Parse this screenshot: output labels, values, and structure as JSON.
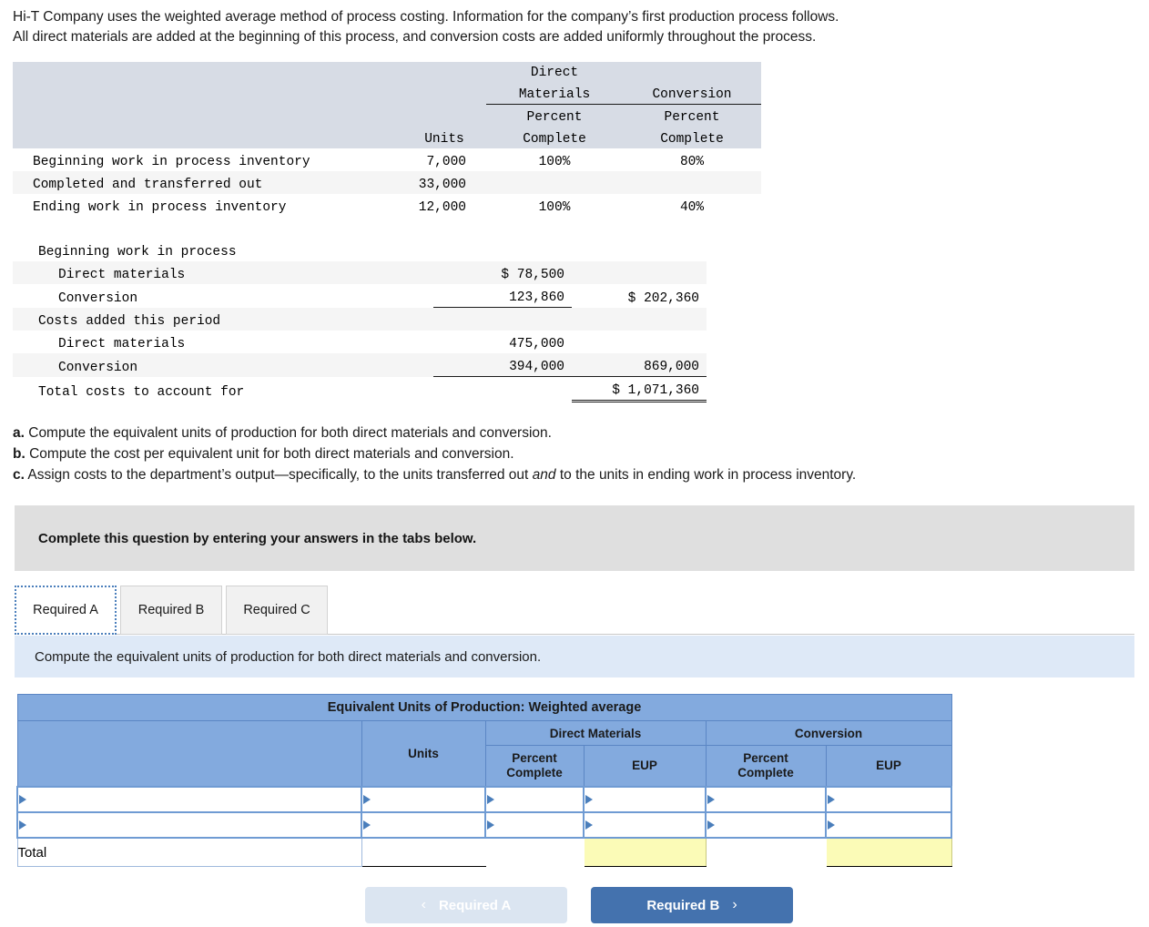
{
  "intro": {
    "line1": "Hi-T Company uses the weighted average method of process costing. Information for the company’s first production process follows.",
    "line2": "All direct materials are added at the beginning of this process, and conversion costs are added uniformly throughout the process."
  },
  "units_table": {
    "group_headers": {
      "direct_materials": "Direct\nMaterials",
      "conversion": "Conversion"
    },
    "columns": [
      "",
      "Units",
      "Percent\nComplete",
      "Percent\nComplete"
    ],
    "col_units": "Units",
    "col_dm_line1": "Direct",
    "col_dm_line2": "Materials",
    "col_conv": "Conversion",
    "col_percent": "Percent",
    "col_complete": "Complete",
    "rows": [
      {
        "label": "Beginning work in process inventory",
        "units": "7,000",
        "dm_pct": "100%",
        "conv_pct": "80%"
      },
      {
        "label": "Completed and transferred out",
        "units": "33,000",
        "dm_pct": "",
        "conv_pct": ""
      },
      {
        "label": "Ending work in process inventory",
        "units": "12,000",
        "dm_pct": "100%",
        "conv_pct": "40%"
      }
    ]
  },
  "costs_table": {
    "rows": [
      {
        "label": "Beginning work in process",
        "indent": 1,
        "amt1": "",
        "amt2": ""
      },
      {
        "label": "Direct materials",
        "indent": 2,
        "amt1": "$ 78,500",
        "amt2": ""
      },
      {
        "label": "Conversion",
        "indent": 2,
        "amt1": "123,860",
        "amt2": "$ 202,360"
      },
      {
        "label": "Costs added this period",
        "indent": 1,
        "amt1": "",
        "amt2": ""
      },
      {
        "label": "Direct materials",
        "indent": 2,
        "amt1": "475,000",
        "amt2": ""
      },
      {
        "label": "Conversion",
        "indent": 2,
        "amt1": "394,000",
        "amt2": "869,000"
      },
      {
        "label": "Total costs to account for",
        "indent": 1,
        "amt1": "",
        "amt2": "$ 1,071,360"
      }
    ]
  },
  "requirements": {
    "a_marker": "a.",
    "a_text": " Compute the equivalent units of production for both direct materials and conversion.",
    "b_marker": "b.",
    "b_text": " Compute the cost per equivalent unit for both direct materials and conversion.",
    "c_marker": "c.",
    "c_text_1": " Assign costs to the department’s output—specifically, to the units transferred out ",
    "c_emph": "and",
    "c_text_2": " to the units in ending work in process inventory."
  },
  "banner": {
    "text": "Complete this question by entering your answers in the tabs below."
  },
  "tabs": [
    {
      "label": "Required A",
      "active": true
    },
    {
      "label": "Required B",
      "active": false
    },
    {
      "label": "Required C",
      "active": false
    }
  ],
  "instruction_bar": {
    "text": "Compute the equivalent units of production for both direct materials and conversion."
  },
  "eup_table": {
    "title": "Equivalent Units of Production: Weighted average",
    "group_dm": "Direct Materials",
    "group_conv": "Conversion",
    "col_units": "Units",
    "col_percent_complete": "Percent Complete",
    "col_percent": "Percent",
    "col_complete": "Complete",
    "col_eup": "EUP",
    "rows": [
      {
        "name": "",
        "units": "",
        "dm_pct": "",
        "dm_eup": "",
        "conv_pct": "",
        "conv_eup": ""
      },
      {
        "name": "",
        "units": "",
        "dm_pct": "",
        "dm_eup": "",
        "conv_pct": "",
        "conv_eup": ""
      }
    ],
    "total": {
      "label": "Total",
      "units": "",
      "dm_pct": "",
      "dm_eup": "",
      "conv_pct": "",
      "conv_eup": ""
    }
  },
  "nav": {
    "prev_label": "Required A",
    "prev_chevron": "‹",
    "next_label": "Required B",
    "next_chevron": "›"
  },
  "colors": {
    "header_blue": "#83aade",
    "instruction_blue": "#dee9f7",
    "banner_gray": "#dfdfdf",
    "fact_header_gray": "#d7dce5",
    "yellow_cell": "#fbfbb7",
    "next_button": "#4472ae",
    "prev_button": "#dbe5f1"
  }
}
